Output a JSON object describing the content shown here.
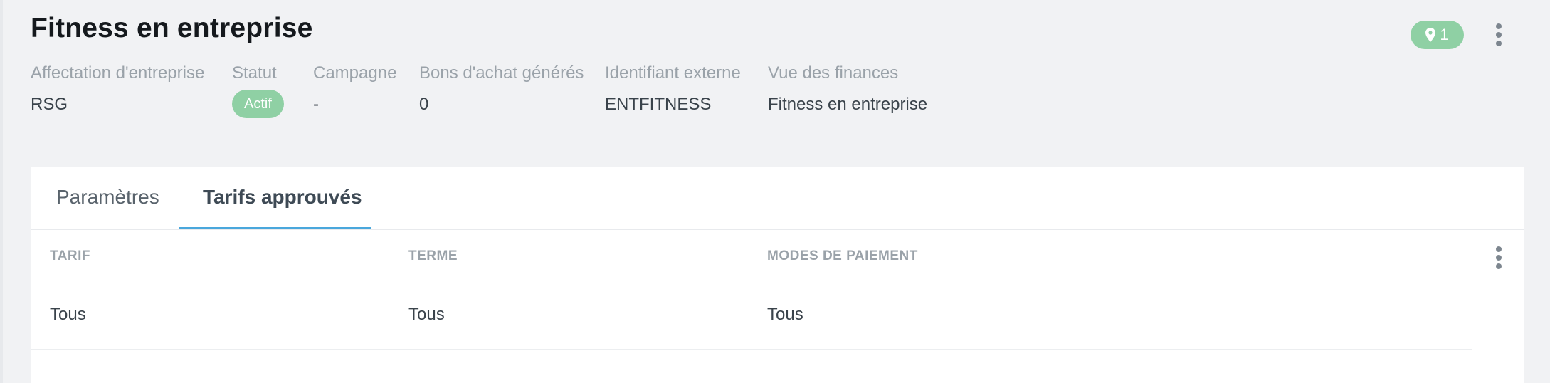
{
  "header": {
    "title": "Fitness en entreprise",
    "location_count": "1",
    "location_icon": "map-pin-icon",
    "menu_icon": "kebab-vertical-icon"
  },
  "meta": {
    "company": {
      "label": "Affectation d'entreprise",
      "value": "RSG"
    },
    "status": {
      "label": "Statut",
      "value": "Actif"
    },
    "campaign": {
      "label": "Campagne",
      "value": "-"
    },
    "vouchers": {
      "label": "Bons d'achat générés",
      "value": "0"
    },
    "external_id": {
      "label": "Identifiant externe",
      "value": "ENTFITNESS"
    },
    "finance_view": {
      "label": "Vue des finances",
      "value": "Fitness en entreprise"
    }
  },
  "tabs": [
    {
      "label": "Paramètres",
      "active": false
    },
    {
      "label": "Tarifs approuvés",
      "active": true
    }
  ],
  "table": {
    "columns": [
      "TARIF",
      "TERME",
      "MODES DE PAIEMENT"
    ],
    "rows": [
      [
        "Tous",
        "Tous",
        "Tous"
      ]
    ]
  },
  "colors": {
    "accent": "#4aa7dc",
    "status_green": "#8fd0a4",
    "background": "#f1f2f4"
  }
}
